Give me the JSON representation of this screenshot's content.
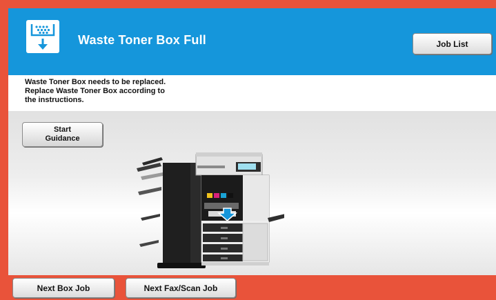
{
  "header": {
    "title": "Waste Toner Box Full",
    "icon": "waste-toner-box-icon",
    "job_list_label": "Job List",
    "color": "#1596db"
  },
  "message": {
    "lines": [
      "Waste Toner Box needs to be replaced.",
      "Replace Waste Toner Box according to",
      "the instructions."
    ]
  },
  "guidance": {
    "line1": "Start",
    "line2": "Guidance"
  },
  "illustration": {
    "icon": "printer-illustration"
  },
  "footer": {
    "next_box_job_label": "Next Box Job",
    "next_fax_scan_job_label": "Next Fax/Scan Job",
    "color": "#e9533a"
  }
}
